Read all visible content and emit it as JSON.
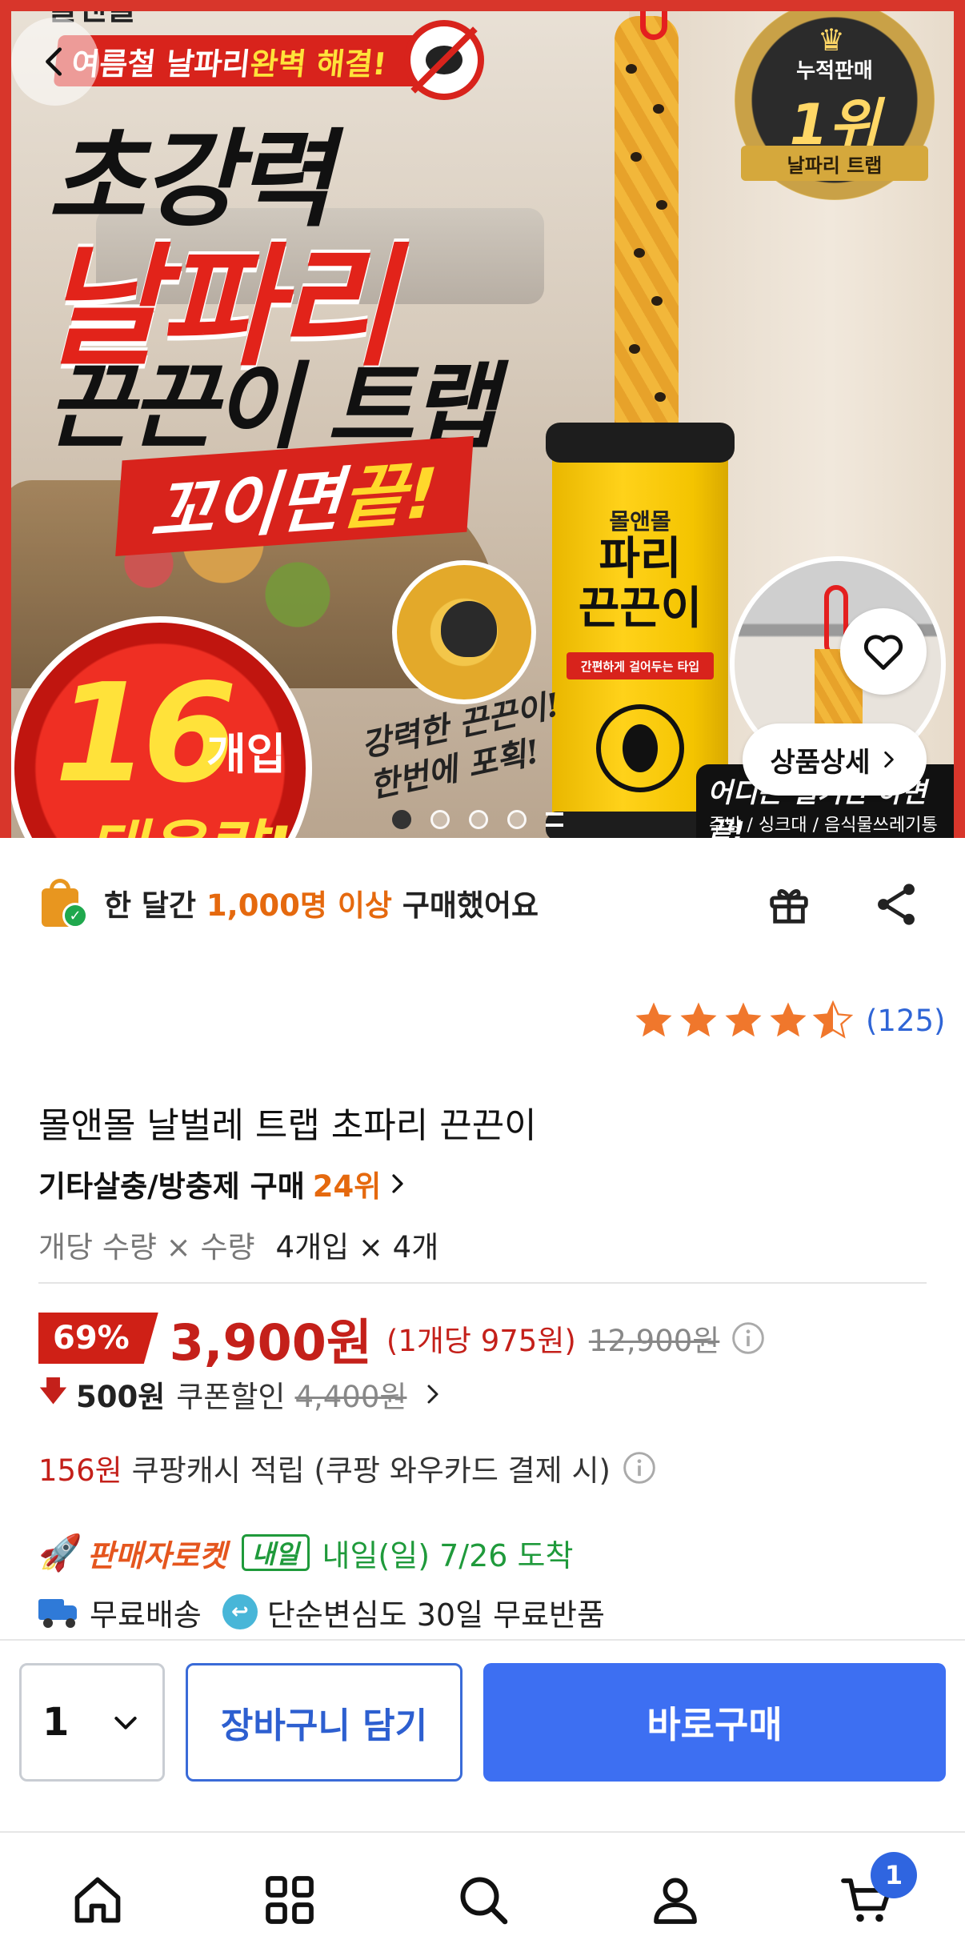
{
  "hero": {
    "brand": "몰앤몰",
    "ribbon_prefix": "여름철 날파리 ",
    "ribbon_highlight": "완벽 해결!",
    "headline_1": "초강력",
    "headline_2": "날파리",
    "headline_3": "끈끈이 트랩",
    "slogan_prefix": "꼬이면 ",
    "slogan_highlight": "끝!",
    "count_number": "16",
    "count_unit": "개입",
    "count_big": "대용량!",
    "handwriting_1": "강력한 끈끈이!",
    "handwriting_2": "한번에 포획!",
    "can_brand": "몰앤몰",
    "can_name_1": "파리",
    "can_name_2": "끈끈이",
    "can_tag": "간편하게 걸어두는 타입",
    "medal_crown": "♛",
    "medal_line_1": "누적판매",
    "medal_line_2": "1위",
    "medal_line_3": "날파리 트랩",
    "detail_button": "상품상세",
    "caption_1": "어디든 걸기만 하면 끝!",
    "caption_2": "주방 / 싱크대 / 음식물쓰레기통",
    "slides_total": 4,
    "slide_active": 1
  },
  "purchase_stats": {
    "prefix": "한 달간 ",
    "highlight": "1,000명 이상",
    "suffix": " 구매했어요",
    "check_mark": "✓"
  },
  "rating": {
    "stars": 4.5,
    "count": "(125)"
  },
  "product": {
    "title": "몰앤몰 날벌레 트랩 초파리 끈끈이",
    "category_rank_label": "기타살충/방충제 구매",
    "category_rank_value": "24위",
    "option_label": "개당 수량 × 수량",
    "option_value": "4개입 × 4개"
  },
  "price": {
    "discount": "69%",
    "current": "3,900원",
    "unit_price": "(1개당 975원)",
    "original": "12,900원",
    "coupon_arrow": "🡇",
    "coupon_amount": "500원",
    "coupon_label": "쿠폰할인",
    "coupon_original": "4,400원",
    "cash_amount": "156원",
    "cash_label": "쿠팡캐시 적립 (쿠팡 와우카드 결제 시)"
  },
  "delivery": {
    "rocket_icon": "🚀",
    "rocket_label": "판매자로켓",
    "tomorrow_badge": "내일",
    "arrival": "내일(일) 7/26 도착",
    "free_shipping": "무료배송",
    "return_icon": "↩",
    "free_return": "단순변심도 30일 무료반품"
  },
  "actions": {
    "quantity": "1",
    "cart_button": "장바구니 담기",
    "buy_button": "바로구매"
  },
  "tabs": {
    "cart_badge": "1"
  },
  "colors": {
    "accent_blue": "#3d6ff2",
    "price_red": "#c4201a",
    "highlight_orange": "#e5690e",
    "delivery_green": "#1f9a3b",
    "star_orange": "#f0772c"
  }
}
